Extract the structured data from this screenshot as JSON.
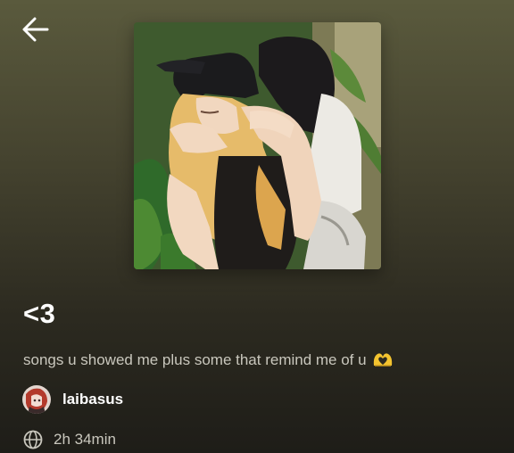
{
  "header": {
    "back_icon": "arrow-left-icon"
  },
  "playlist": {
    "cover_alt": "playlist-cover-artwork",
    "title": "<3",
    "description": "songs u showed me plus some that remind me of u",
    "description_emoji": "heart-hands-icon",
    "owner": {
      "name": "laibasus",
      "avatar": "user-avatar"
    },
    "duration": "2h 34min",
    "duration_icon": "globe-icon"
  },
  "colors": {
    "background_top": "#5a5a3d",
    "background_bottom": "#1e1d18",
    "text_primary": "#ffffff",
    "text_secondary": "#c9c7bd",
    "emoji_yellow": "#f4c430"
  }
}
